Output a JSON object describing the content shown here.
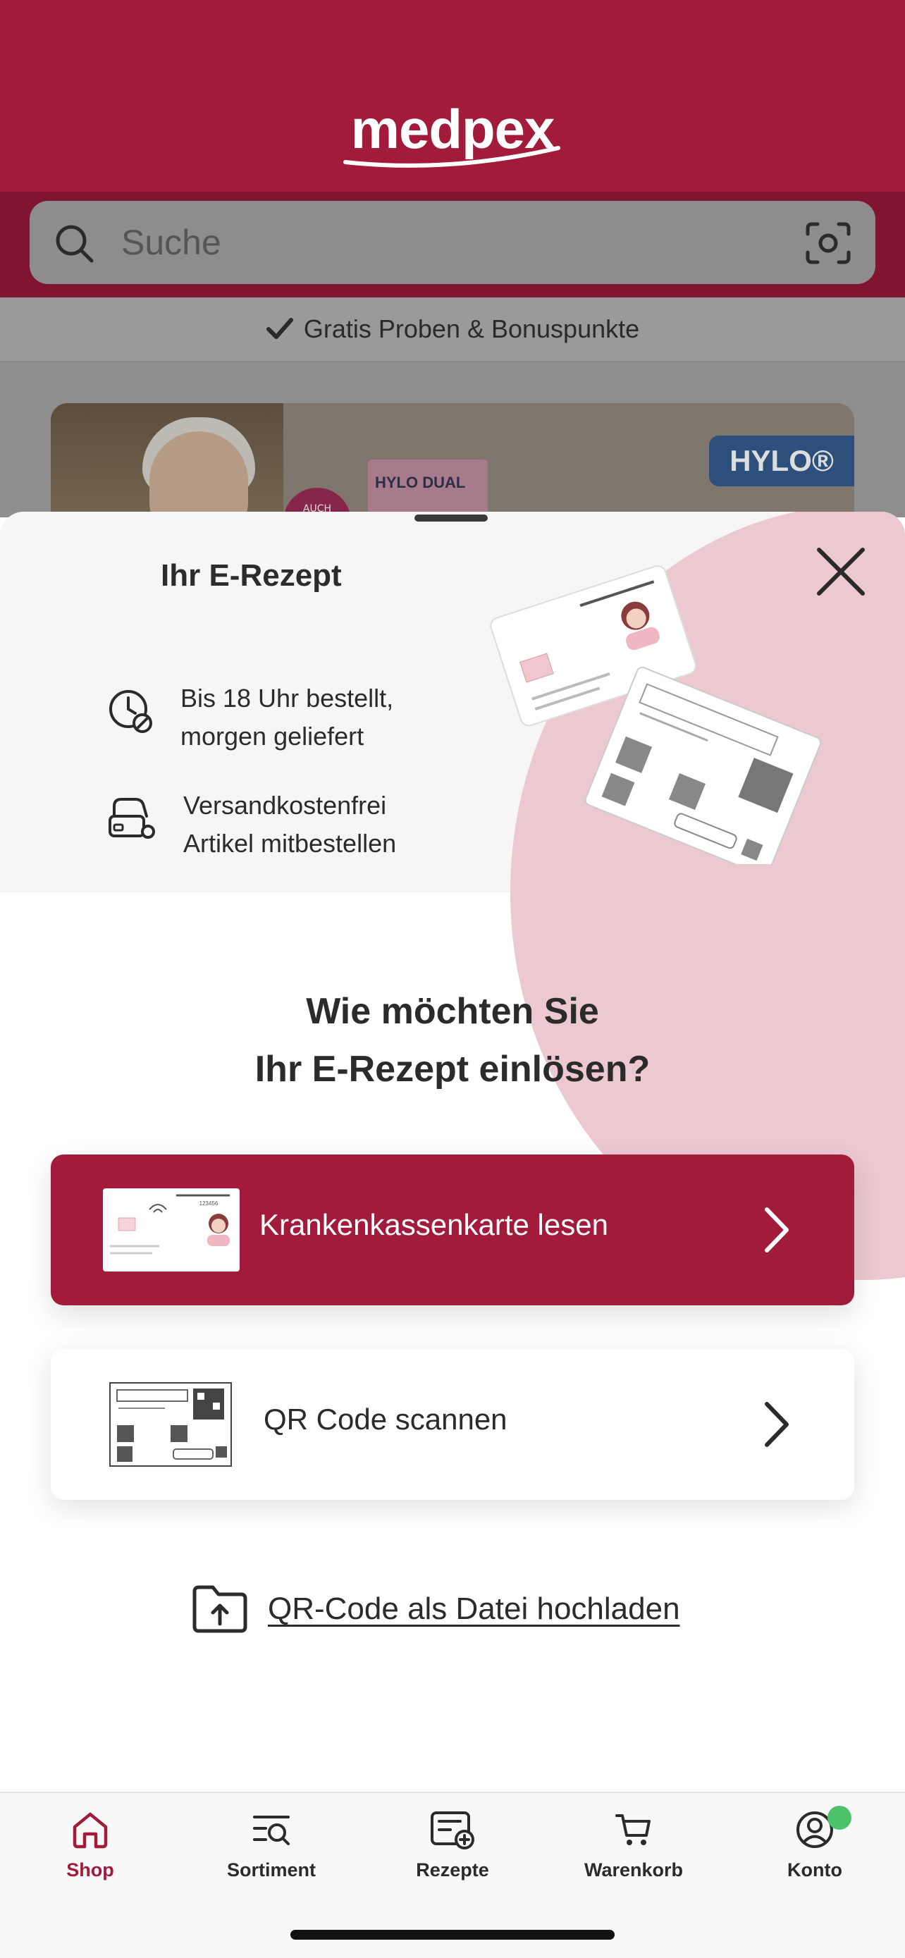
{
  "app": {
    "logo": "medpex"
  },
  "search": {
    "placeholder": "Suche"
  },
  "benefit_banner": {
    "text": "Gratis Proben & Bonuspunkte"
  },
  "promo": {
    "brand": "HYLO®",
    "badge": "AUCH",
    "product": "HYLO DUAL"
  },
  "sheet": {
    "title": "Ihr E-Rezept",
    "features": [
      {
        "icon": "clock-delivery-icon",
        "text": "Bis 18 Uhr bestellt,\nmorgen geliefert"
      },
      {
        "icon": "shipping-free-icon",
        "text": "Versandkostenfrei\nArtikel mitbestellen"
      }
    ],
    "question": "Wie möchten Sie\nIhr E-Rezept einlösen?",
    "options": [
      {
        "label": "Krankenkassenkarte lesen",
        "thumb": "health-card-icon"
      },
      {
        "label": "QR Code scannen",
        "thumb": "qr-prescription-icon"
      }
    ],
    "upload_link": "QR-Code als Datei hochladen"
  },
  "tabbar": {
    "items": [
      {
        "label": "Shop",
        "icon": "home-icon",
        "active": true
      },
      {
        "label": "Sortiment",
        "icon": "catalog-search-icon"
      },
      {
        "label": "Rezepte",
        "icon": "prescription-add-icon"
      },
      {
        "label": "Warenkorb",
        "icon": "cart-icon"
      },
      {
        "label": "Konto",
        "icon": "account-icon",
        "badge": true
      }
    ]
  },
  "colors": {
    "brand": "#a31b3a",
    "pink": "#ecc8d0",
    "badge_green": "#4cc36a"
  }
}
